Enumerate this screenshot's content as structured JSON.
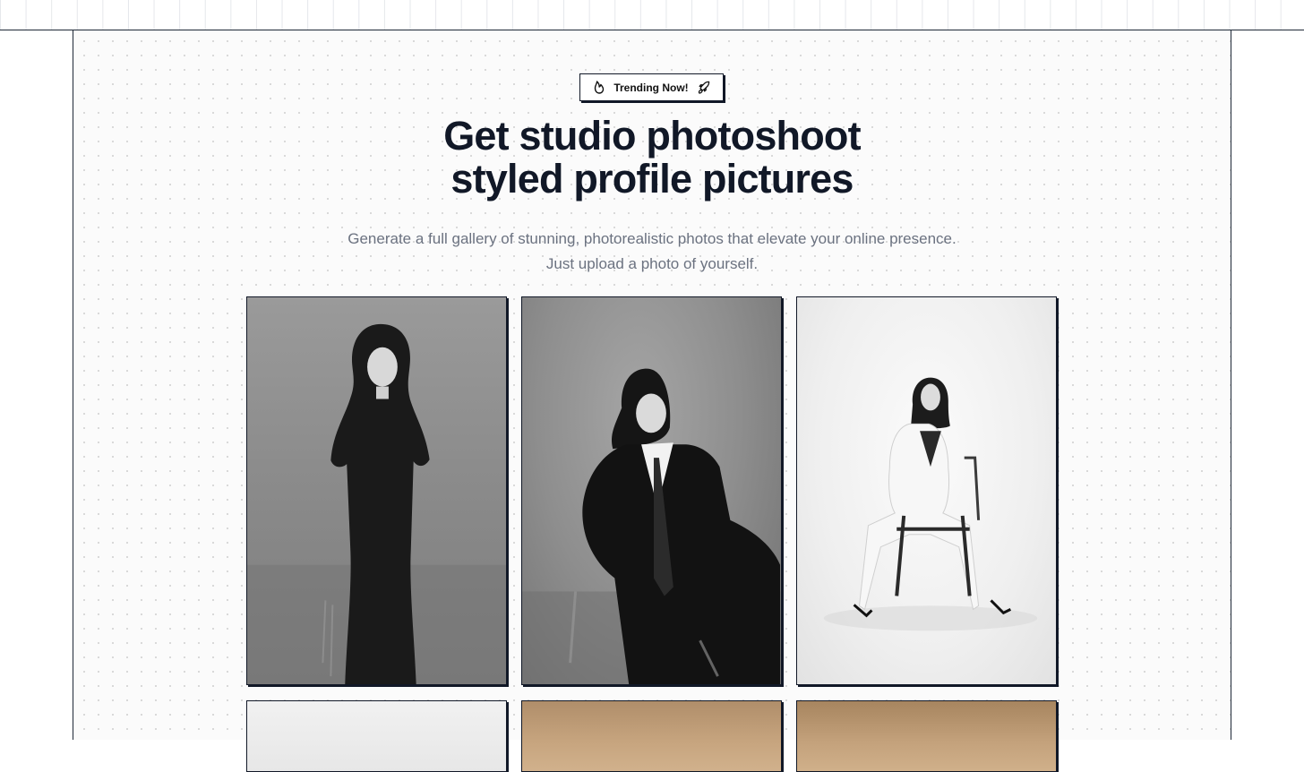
{
  "badge": {
    "label": "Trending Now!",
    "left_icon": "flame-icon",
    "right_icon": "rocket-icon"
  },
  "hero": {
    "title_line1": "Get studio photoshoot",
    "title_line2": "styled profile pictures",
    "subtitle_line1": "Generate a full gallery of stunning, photorealistic photos that elevate your online presence.",
    "subtitle_line2": "Just upload a photo of yourself."
  },
  "gallery": {
    "photos": [
      "studio-portrait-black-dress",
      "studio-portrait-black-suit-seated",
      "studio-portrait-white-suit-chair",
      "studio-portrait-light-background",
      "studio-portrait-warm-background",
      "studio-portrait-warm-background"
    ]
  }
}
